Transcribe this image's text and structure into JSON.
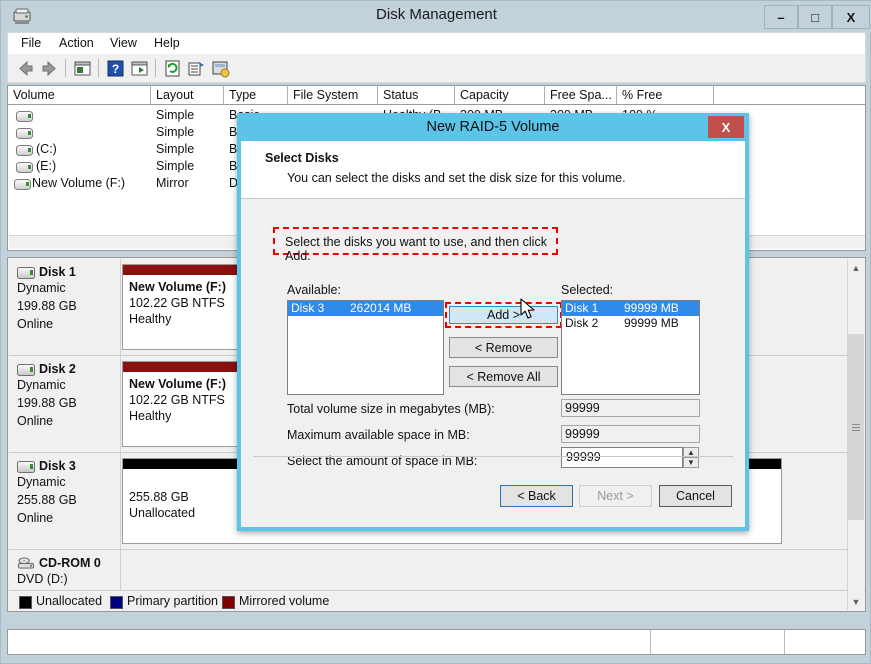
{
  "window": {
    "title": "Disk Management",
    "icon": "disk-management-icon",
    "minimize_label": "–",
    "maximize_label": "□",
    "close_label": "X"
  },
  "menubar": {
    "items": [
      "File",
      "Action",
      "View",
      "Help"
    ]
  },
  "toolbar": {
    "icons": [
      "back-arrow-icon",
      "forward-arrow-icon",
      "show-list-icon",
      "help-icon",
      "show-graphical-icon",
      "rescan-disks-icon",
      "properties-icon",
      "create-vhd-icon"
    ]
  },
  "volume_list": {
    "columns": [
      "Volume",
      "Layout",
      "Type",
      "File System",
      "Status",
      "Capacity",
      "Free Spa...",
      "% Free",
      ""
    ],
    "rows": [
      {
        "volume": "",
        "layout": "Simple",
        "type": "Basic",
        "filesystem": "",
        "status": "Healthy (B",
        "capacity": "300 MB",
        "free": "300 MB",
        "pctfree": "100 %"
      },
      {
        "volume": "",
        "layout": "Simple",
        "type": "Bas",
        "filesystem": "",
        "status": "",
        "capacity": "",
        "free": "",
        "pctfree": ""
      },
      {
        "volume": "(C:)",
        "layout": "Simple",
        "type": "Bas",
        "filesystem": "",
        "status": "",
        "capacity": "",
        "free": "",
        "pctfree": ""
      },
      {
        "volume": "(E:)",
        "layout": "Simple",
        "type": "Bas",
        "filesystem": "",
        "status": "",
        "capacity": "",
        "free": "",
        "pctfree": ""
      },
      {
        "volume": "New Volume (F:)",
        "layout": "Mirror",
        "type": "Dy",
        "filesystem": "",
        "status": "",
        "capacity": "",
        "free": "",
        "pctfree": ""
      }
    ]
  },
  "disk_view": {
    "disks": [
      {
        "name": "Disk 1",
        "kind": "Dynamic",
        "size": "199.88 GB",
        "state": "Online",
        "partitions": [
          {
            "title": "New Volume  (F:)",
            "line2": "102.22 GB NTFS",
            "line3": "Healthy",
            "bar_color": "#8b1010",
            "hatched": false
          },
          {
            "title": "",
            "line2": "",
            "line3": "",
            "bar_color": "#000000",
            "hatched": true
          }
        ]
      },
      {
        "name": "Disk 2",
        "kind": "Dynamic",
        "size": "199.88 GB",
        "state": "Online",
        "partitions": [
          {
            "title": "New Volume  (F:)",
            "line2": "102.22 GB NTFS",
            "line3": "Healthy",
            "bar_color": "#8b1010",
            "hatched": false
          },
          {
            "title": "",
            "line2": "",
            "line3": "",
            "bar_color": "#000000",
            "hatched": false
          }
        ]
      },
      {
        "name": "Disk 3",
        "kind": "Dynamic",
        "size": "255.88 GB",
        "state": "Online",
        "partitions": [
          {
            "title": "",
            "line2": "255.88 GB",
            "line3": "Unallocated",
            "bar_color": "#000000",
            "hatched": false
          }
        ]
      },
      {
        "name": "CD-ROM 0",
        "kind": "DVD (D:)",
        "size": "",
        "state": "",
        "partitions": []
      }
    ],
    "legend": [
      {
        "label": "Unallocated",
        "color": "#000000"
      },
      {
        "label": "Primary partition",
        "color": "#000080"
      },
      {
        "label": "Mirrored volume",
        "color": "#800000"
      }
    ]
  },
  "statusbar": {
    "segments": [
      "",
      "",
      ""
    ]
  },
  "dialog": {
    "title": "New RAID-5 Volume",
    "close_label": "X",
    "heading": "Select Disks",
    "subheading": "You can select the disks and set the disk size for this volume.",
    "hint": "Select the disks you want to use, and then click Add.",
    "available_label": "Available:",
    "selected_label": "Selected:",
    "available_disks": [
      {
        "name": "Disk 3",
        "size": "262014 MB",
        "selected": true
      }
    ],
    "selected_disks": [
      {
        "name": "Disk 1",
        "size": "99999 MB",
        "selected": true
      },
      {
        "name": "Disk 2",
        "size": "99999 MB",
        "selected": false
      }
    ],
    "add_button": "Add >",
    "remove_button": "< Remove",
    "remove_all_button": "< Remove All",
    "total_size_label": "Total volume size in megabytes (MB):",
    "total_size_value": "99999",
    "max_space_label": "Maximum available space in MB:",
    "max_space_value": "99999",
    "select_space_label": "Select the amount of space in MB:",
    "select_space_value": "99999",
    "spin_up": "▲",
    "spin_down": "▼",
    "back_button": "< Back",
    "next_button": "Next >",
    "cancel_button": "Cancel"
  },
  "annotations": {
    "hint_box_color": "#ee0000",
    "add_box_color": "#ee0000"
  }
}
